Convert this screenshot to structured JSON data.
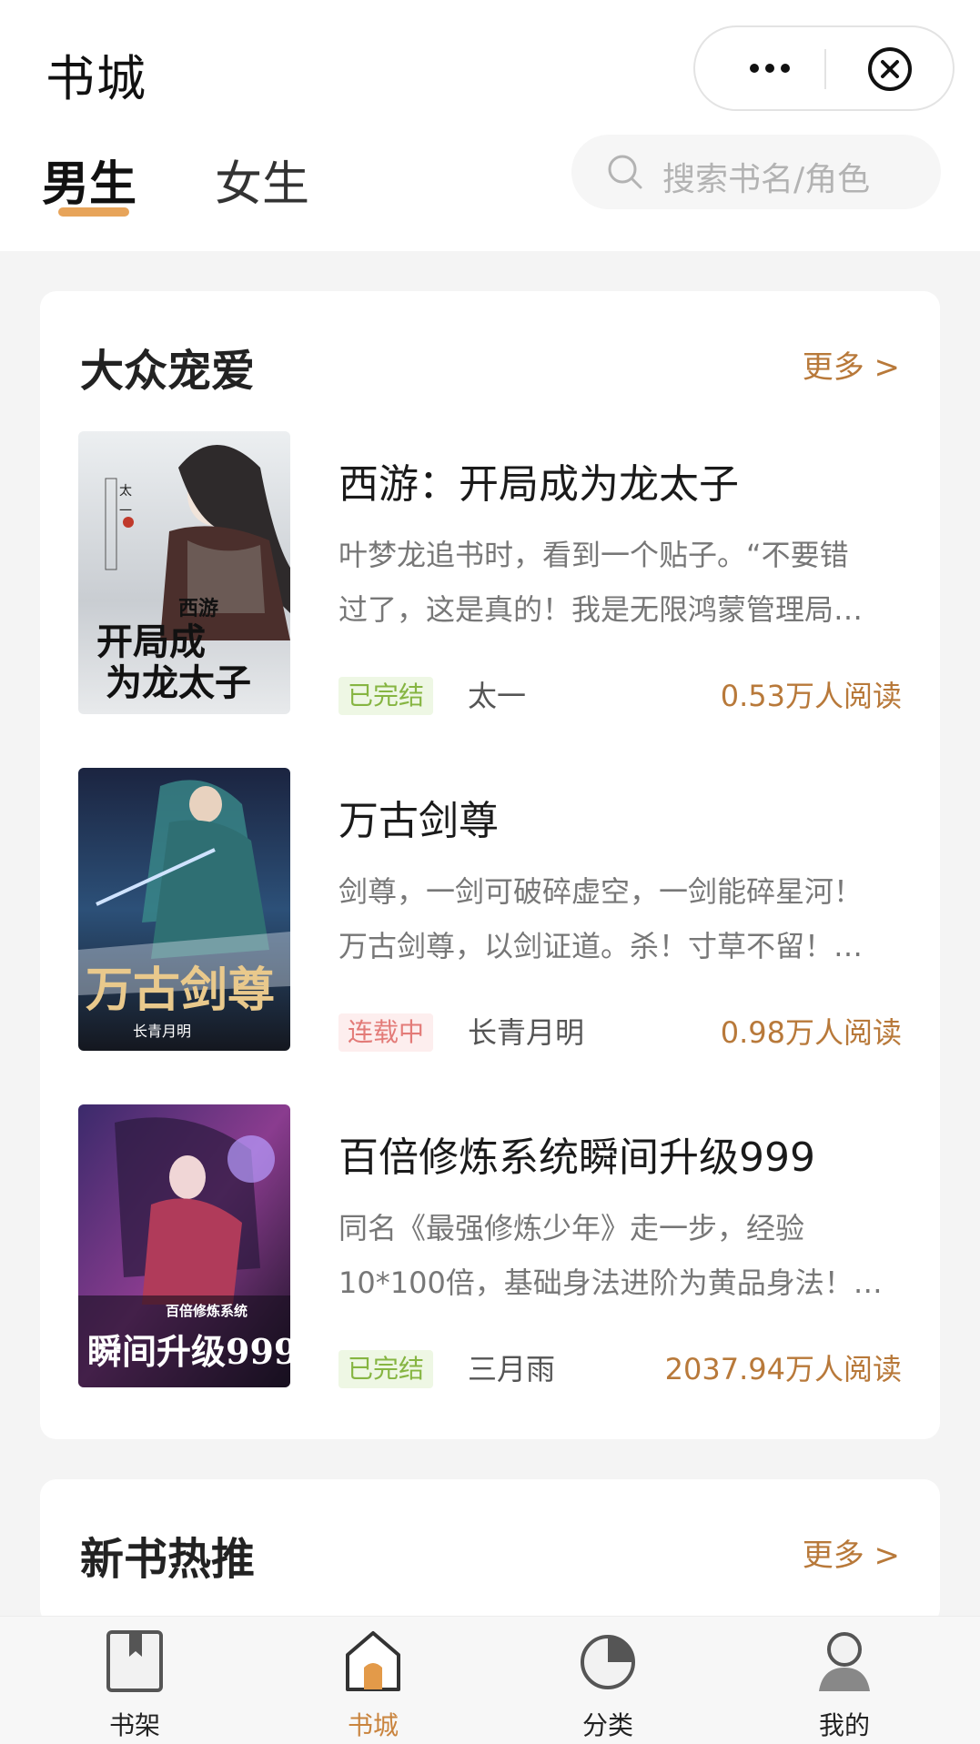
{
  "header": {
    "title": "书城",
    "tabs": [
      {
        "label": "男生",
        "active": true
      },
      {
        "label": "女生",
        "active": false
      }
    ],
    "search": {
      "placeholder": "搜索书名/角色"
    },
    "accent_color": "#e7a45a"
  },
  "sections": [
    {
      "title": "大众宠爱",
      "more": "更多 >",
      "books": [
        {
          "title": "西游：开局成为龙太子",
          "desc_lines": [
            "叶梦龙追书时，看到一个贴子。“不要错",
            "过了，这是真的！我是无限鸿蒙管理局…"
          ],
          "status": "已完结",
          "author": "太一",
          "reads": "0.53万人阅读",
          "cover_text": "开局成为龙太子",
          "cover_sub": "西游"
        },
        {
          "title": "万古剑尊",
          "desc_lines": [
            "剑尊，一剑可破碎虚空，一剑能碎星河！",
            "万古剑尊，以剑证道。杀！寸草不留！…"
          ],
          "status": "连载中",
          "author": "长青月明",
          "reads": "0.98万人阅读",
          "cover_text": "万古剑尊",
          "cover_sub": "长青月明"
        },
        {
          "title": "百倍修炼系统瞬间升级999",
          "desc_lines": [
            "同名《最强修炼少年》走一步，经验",
            "10*100倍，基础身法进阶为黄品身法！…"
          ],
          "status": "已完结",
          "author": "三月雨",
          "reads": "2037.94万人阅读",
          "cover_text": "瞬间升级999",
          "cover_sub": "百倍修炼系统"
        }
      ]
    },
    {
      "title": "新书热推",
      "more": "更多 >"
    }
  ],
  "tabbar": [
    {
      "label": "书架",
      "icon": "bookshelf-icon",
      "active": false
    },
    {
      "label": "书城",
      "icon": "store-icon",
      "active": true
    },
    {
      "label": "分类",
      "icon": "category-icon",
      "active": false
    },
    {
      "label": "我的",
      "icon": "profile-icon",
      "active": false
    }
  ]
}
